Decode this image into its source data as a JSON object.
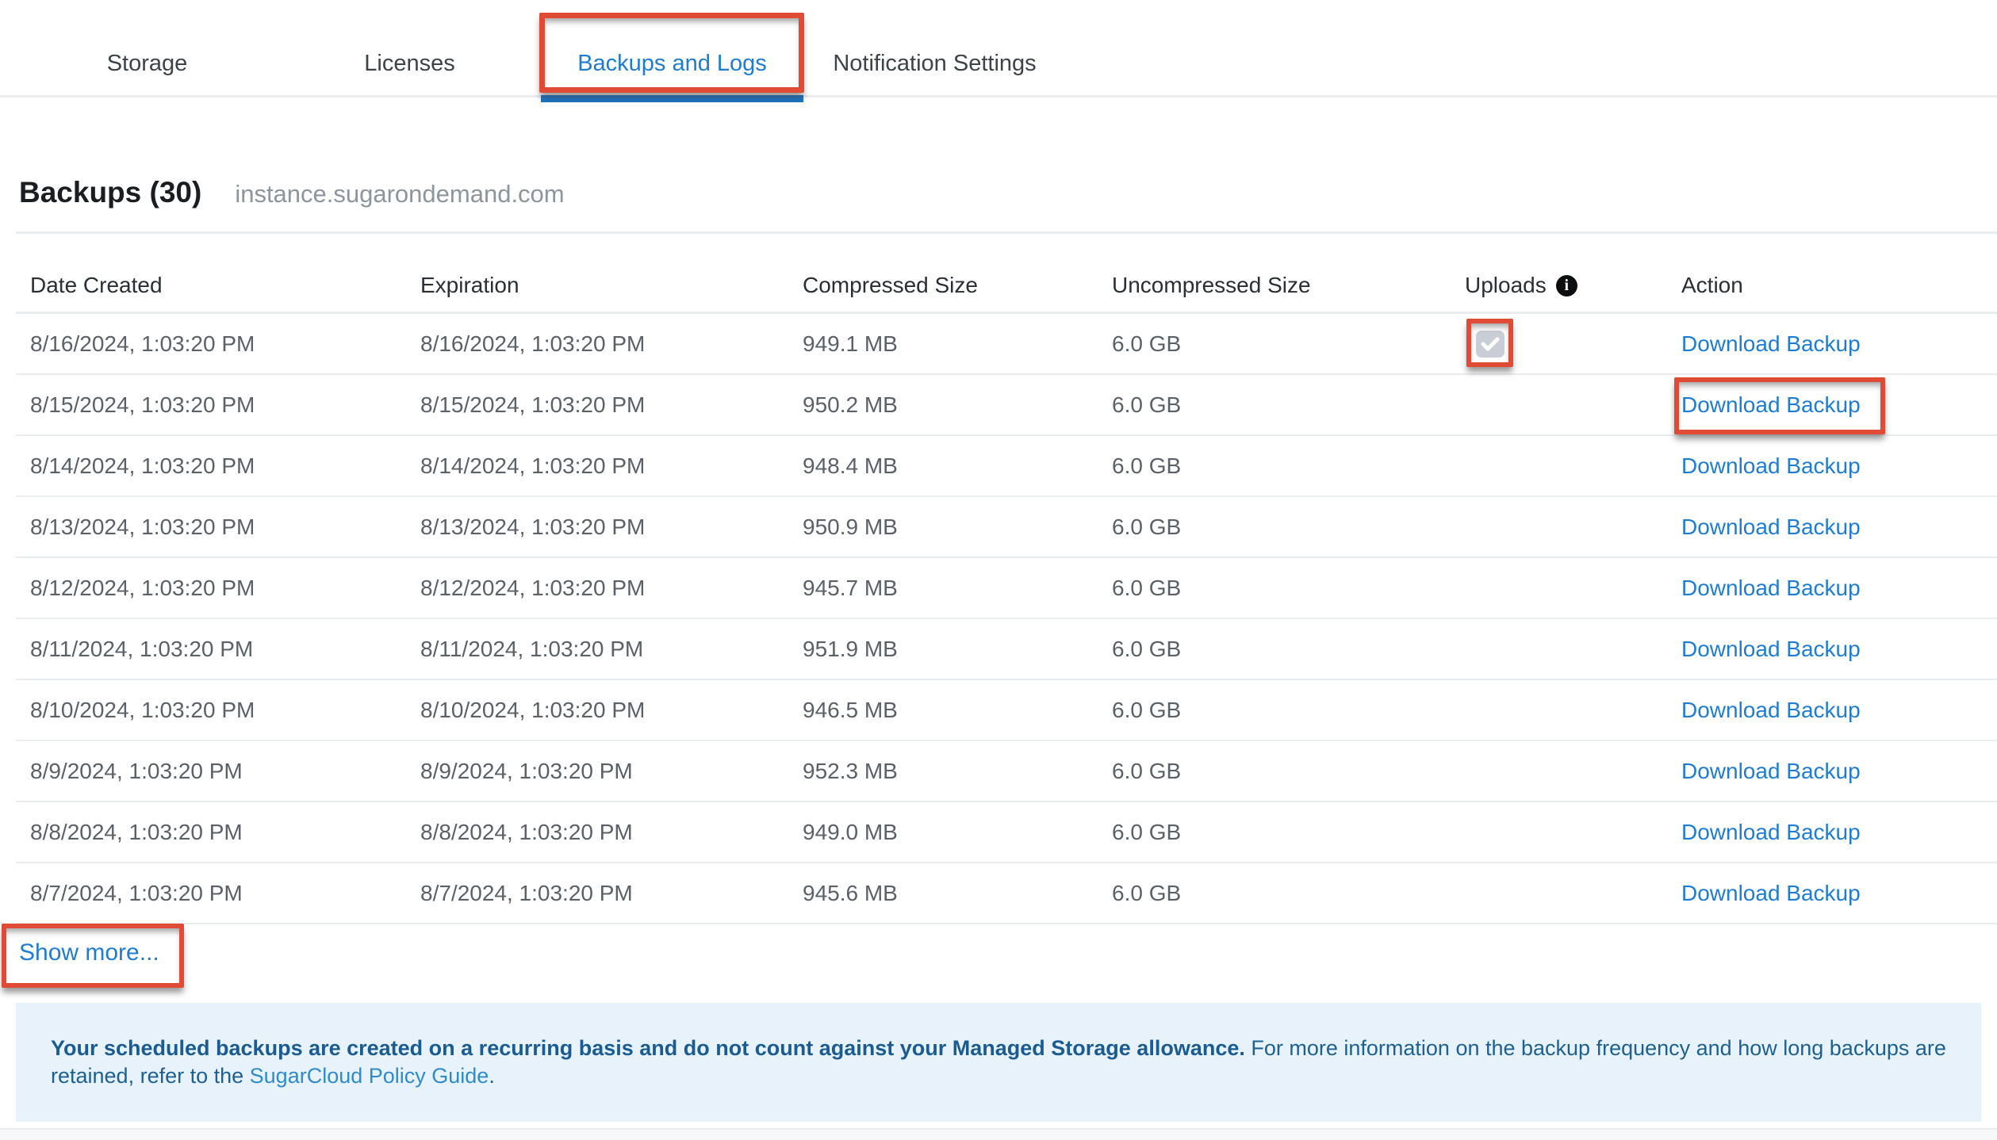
{
  "tabs": {
    "items": [
      {
        "label": "Storage",
        "active": false
      },
      {
        "label": "Licenses",
        "active": false
      },
      {
        "label": "Backups and Logs",
        "active": true
      },
      {
        "label": "Notification Settings",
        "active": false
      }
    ]
  },
  "section": {
    "title": "Backups (30)",
    "domain": "instance.sugarondemand.com"
  },
  "table": {
    "columns": [
      "Date Created",
      "Expiration",
      "Compressed Size",
      "Uncompressed Size",
      "Uploads",
      "Action"
    ],
    "uploads_info_icon": "i",
    "action_label": "Download Backup",
    "rows": [
      {
        "date_created": "8/16/2024, 1:03:20 PM",
        "expiration": "8/16/2024, 1:03:20 PM",
        "compressed": "949.1 MB",
        "uncompressed": "6.0 GB",
        "upload_checked": true
      },
      {
        "date_created": "8/15/2024, 1:03:20 PM",
        "expiration": "8/15/2024, 1:03:20 PM",
        "compressed": "950.2 MB",
        "uncompressed": "6.0 GB",
        "upload_checked": false
      },
      {
        "date_created": "8/14/2024, 1:03:20 PM",
        "expiration": "8/14/2024, 1:03:20 PM",
        "compressed": "948.4 MB",
        "uncompressed": "6.0 GB",
        "upload_checked": false
      },
      {
        "date_created": "8/13/2024, 1:03:20 PM",
        "expiration": "8/13/2024, 1:03:20 PM",
        "compressed": "950.9 MB",
        "uncompressed": "6.0 GB",
        "upload_checked": false
      },
      {
        "date_created": "8/12/2024, 1:03:20 PM",
        "expiration": "8/12/2024, 1:03:20 PM",
        "compressed": "945.7 MB",
        "uncompressed": "6.0 GB",
        "upload_checked": false
      },
      {
        "date_created": "8/11/2024, 1:03:20 PM",
        "expiration": "8/11/2024, 1:03:20 PM",
        "compressed": "951.9 MB",
        "uncompressed": "6.0 GB",
        "upload_checked": false
      },
      {
        "date_created": "8/10/2024, 1:03:20 PM",
        "expiration": "8/10/2024, 1:03:20 PM",
        "compressed": "946.5 MB",
        "uncompressed": "6.0 GB",
        "upload_checked": false
      },
      {
        "date_created": "8/9/2024, 1:03:20 PM",
        "expiration": "8/9/2024, 1:03:20 PM",
        "compressed": "952.3 MB",
        "uncompressed": "6.0 GB",
        "upload_checked": false
      },
      {
        "date_created": "8/8/2024, 1:03:20 PM",
        "expiration": "8/8/2024, 1:03:20 PM",
        "compressed": "949.0 MB",
        "uncompressed": "6.0 GB",
        "upload_checked": false
      },
      {
        "date_created": "8/7/2024, 1:03:20 PM",
        "expiration": "8/7/2024, 1:03:20 PM",
        "compressed": "945.6 MB",
        "uncompressed": "6.0 GB",
        "upload_checked": false
      }
    ]
  },
  "show_more": {
    "label": "Show more..."
  },
  "banner": {
    "bold_text": "Your scheduled backups are created on a recurring basis and do not count against your Managed Storage allowance.",
    "text_before_link": " For more information on the backup frequency and how long backups are retained, refer to the ",
    "link_text": "SugarCloud Policy Guide",
    "text_after_link": "."
  },
  "colors": {
    "accent_blue": "#1e7dd2",
    "active_tab_bar_blue": "#1b72c4",
    "annotation_red": "#e04b36",
    "banner_background": "#e7f2fa",
    "banner_text": "#1d6194",
    "checkbox_gray": "#c9ced6"
  }
}
